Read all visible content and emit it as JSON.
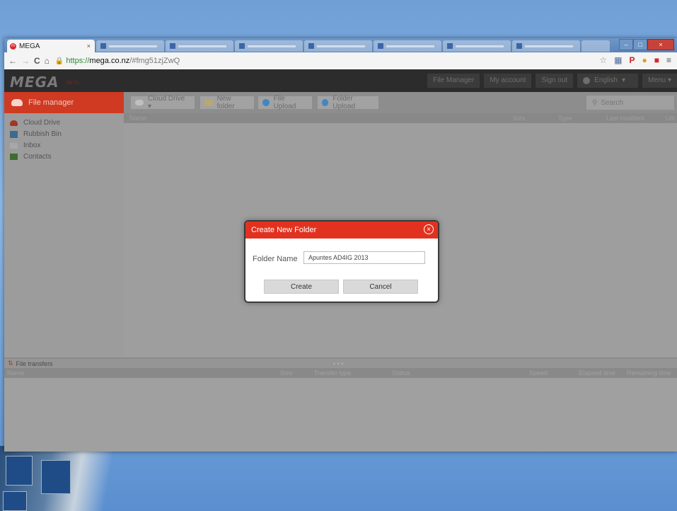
{
  "browser": {
    "active_tab": {
      "title": "MEGA",
      "close": "×"
    },
    "background_tab_count": 8,
    "address": {
      "scheme": "https://",
      "host": "mega.co.nz",
      "path": "/#fmg51zjZwQ"
    },
    "nav": {
      "back": "←",
      "forward": "→",
      "reload": "C",
      "home": "⌂"
    },
    "window_controls": {
      "minimize": "–",
      "maximize": "□",
      "close": "×"
    }
  },
  "app": {
    "logo": "MEGA",
    "beta": "BETA",
    "topnav": [
      "File Manager",
      "My account",
      "Sign out"
    ],
    "language": "English",
    "menu": "Menu",
    "sidebar_title": "File manager",
    "toolbar": {
      "cloud_drive": "Cloud Drive ▾",
      "new_folder": "New folder",
      "file_upload": "File Upload",
      "folder_upload": "Folder Upload",
      "search_placeholder": "Search"
    },
    "sidebar_items": [
      "Cloud Drive",
      "Rubbish Bin",
      "Inbox",
      "Contacts"
    ],
    "file_columns": [
      "Name",
      "Size",
      "Type",
      "Last modified",
      "Ulti"
    ],
    "transfers": {
      "title": "File transfers",
      "columns": [
        "Name",
        "Size",
        "Transfer type",
        "Status",
        "Speed",
        "Elapsed time",
        "Remaining time"
      ]
    }
  },
  "dialog": {
    "title": "Create New Folder",
    "label": "Folder Name",
    "value": "Apuntes AD4IG 2013",
    "create": "Create",
    "cancel": "Cancel"
  },
  "colors": {
    "mega_red": "#d9272e",
    "dialog_red": "#e1321f"
  }
}
